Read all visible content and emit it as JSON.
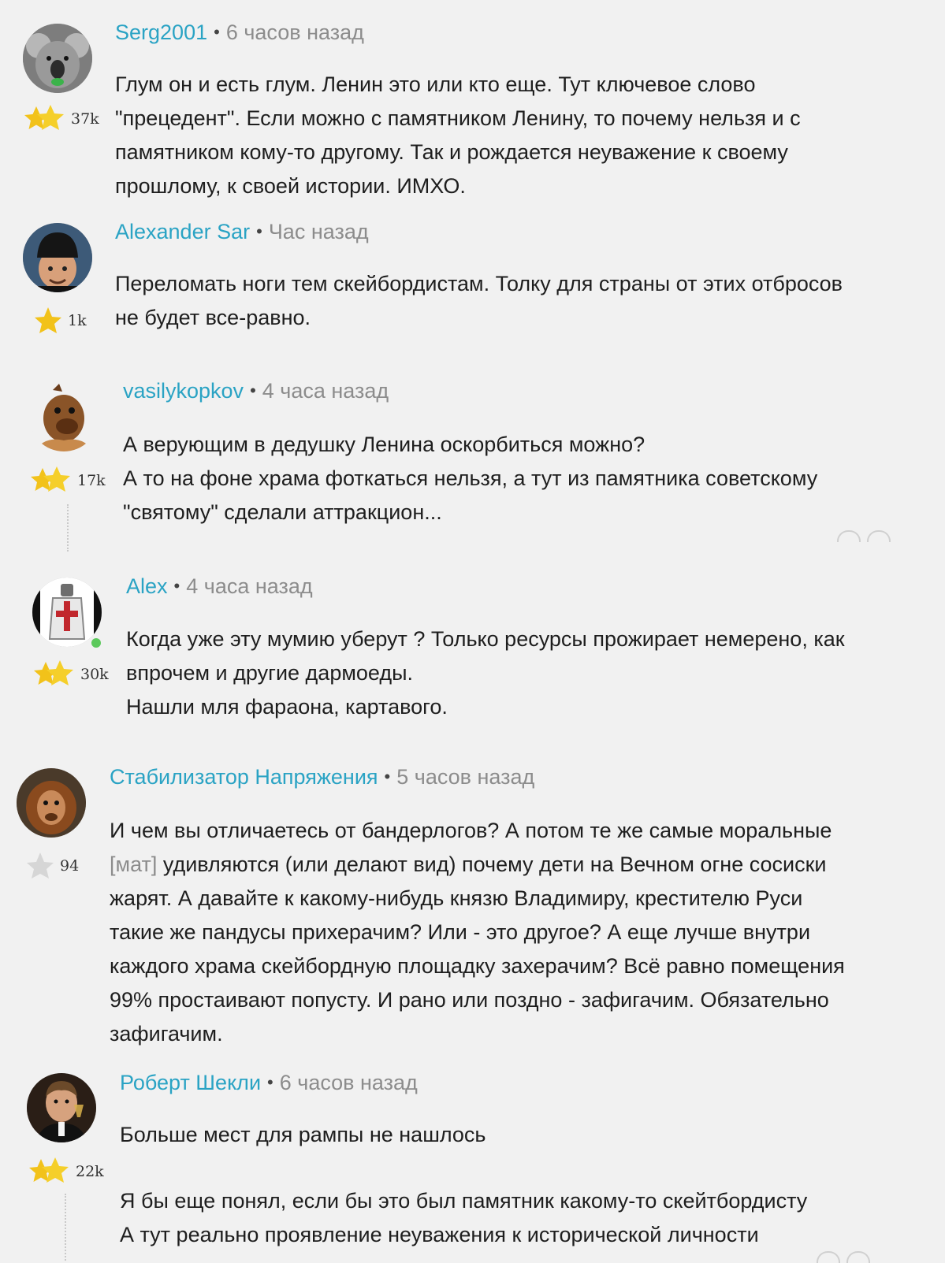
{
  "comments": [
    {
      "author": "Serg2001",
      "time": "6 часов назад",
      "rating": "37k",
      "avatar_icon": "koala-avatar-icon",
      "lines": [
        "Глум он и есть глум. Ленин это или кто еще. Тут ключевое слово",
        "\"прецедент\". Если можно с памятником Ленину, то почему нельзя и с",
        "памятником кому-то другому. Так и рождается неуважение к своему",
        "прошлому, к своей истории. ИМХО."
      ]
    },
    {
      "author": "Alexander Sar",
      "time": "Час назад",
      "rating": "1k",
      "avatar_icon": "man-in-hat-avatar-icon",
      "lines": [
        "Переломать ноги тем скейбордистам. Толку для страны от этих отбросов",
        "не будет все-равно."
      ]
    },
    {
      "author": "vasilykopkov",
      "time": "4 часа назад",
      "rating": "17k",
      "avatar_icon": "alf-avatar-icon",
      "lines": [
        "А верующим в дедушку Ленина оскорбиться можно?",
        "А то на фоне храма фоткаться нельзя, а тут из памятника советскому",
        "\"святому\" сделали аттракцион..."
      ]
    },
    {
      "author": "Alex",
      "time": "4 часа назад",
      "rating": "30k",
      "avatar_icon": "knight-avatar-icon",
      "lines": [
        "Когда уже эту мумию уберут ? Только ресурсы прожирает немерено, как",
        "впрочем и другие дармоеды.",
        "Нашли мля фараона, картавого."
      ]
    },
    {
      "author": "Стабилизатор Напряжения",
      "time": "5 часов назад",
      "rating": "94",
      "avatar_icon": "orangutan-avatar-icon",
      "mat": "[мат]",
      "lines": [
        "И чем вы отличаетесь от бандерлогов? А потом те же самые моральные",
        " удивляются (или делают вид) почему дети на Вечном огне сосиски",
        "жарят. А давайте к какому-нибудь князю Владимиру, крестителю Руси",
        "такие же пандусы прихерачим? Или - это другое? А еще лучше внутри",
        "каждого храма скейбордную площадку захерачим? Всё равно помещения",
        "99% простаивают попусту. И рано или поздно - зафигачим. Обязательно",
        "зафигачим."
      ]
    },
    {
      "author": "Роберт Шекли",
      "time": "6 часов назад",
      "rating": "22k",
      "avatar_icon": "man-with-glass-avatar-icon",
      "lines": [
        "Больше мест для рампы не нашлось",
        "Я бы еще понял, если бы это был памятник какому-то скейтбордисту",
        "А тут реально проявление неуважения к исторической личности"
      ]
    }
  ]
}
